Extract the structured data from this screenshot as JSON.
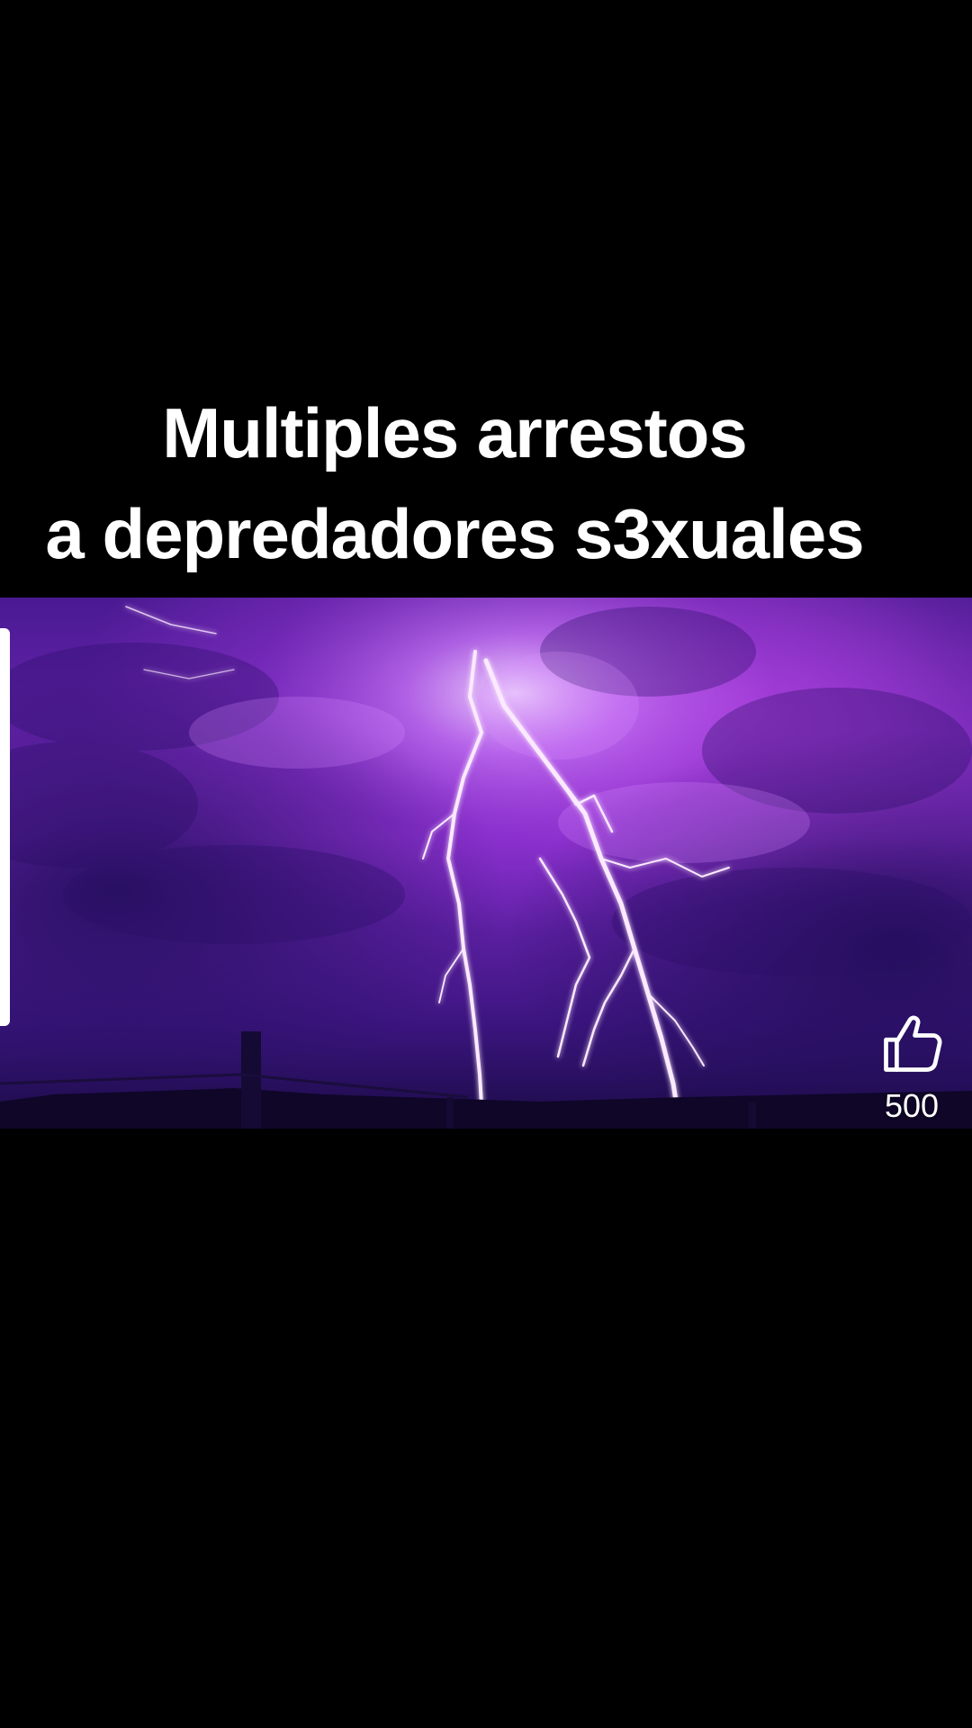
{
  "caption": {
    "line1": "Multiples arrestos",
    "line2": "a depredadores s3xuales"
  },
  "media": {
    "icon": "lightning-storm-image",
    "colors": {
      "sky_top": "#3a1479",
      "sky_mid": "#8d2fd0",
      "sky_glow": "#e7b6ff",
      "horizon": "#120733",
      "bolt": "#fbe9ff"
    }
  },
  "like": {
    "icon": "thumbs-up-icon",
    "count": "500"
  }
}
